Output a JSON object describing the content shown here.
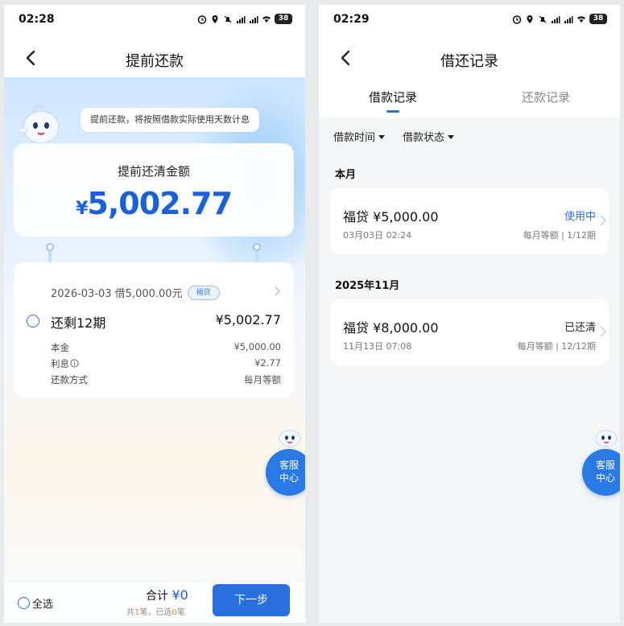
{
  "left": {
    "status_time": "02:28",
    "battery": "38",
    "title": "提前还款",
    "tip": "提前还款，将按照借款实际使用天数计息",
    "amount_label": "提前还清金额",
    "amount_currency": "¥",
    "amount_value": "5,002.77",
    "loan": {
      "header": "2026-03-03 借5,000.00元",
      "tag": "福贷",
      "periods": "还剩12期",
      "total": "¥5,002.77",
      "details": [
        {
          "label": "本金",
          "value": "¥5,000.00"
        },
        {
          "label": "利息",
          "value": "¥2.77"
        },
        {
          "label": "还款方式",
          "value": "每月等额"
        }
      ]
    },
    "service_line1": "客服",
    "service_line2": "中心",
    "select_all": "全选",
    "sum_label": "合计",
    "sum_amount": "¥0",
    "sum_sub_prefix": "共",
    "sum_sub_count": "1",
    "sum_sub_mid": "笔，已选",
    "sum_sub_selected": "0",
    "sum_sub_suffix": "笔",
    "next_button": "下一步"
  },
  "right": {
    "status_time": "02:29",
    "battery": "38",
    "title": "借还记录",
    "tabs": [
      "借款记录",
      "还款记录"
    ],
    "filters": [
      "借款时间",
      "借款状态"
    ],
    "groups": [
      {
        "title": "本月",
        "record": {
          "name": "福贷 ¥5,000.00",
          "time": "03月03日 02:24",
          "status": "使用中",
          "method": "每月等额",
          "progress": "1/12期"
        }
      },
      {
        "title": "2025年11月",
        "record": {
          "name": "福贷 ¥8,000.00",
          "time": "11月13日 07:08",
          "status": "已还清",
          "method": "每月等额",
          "progress": "12/12期"
        }
      }
    ],
    "service_line1": "客服",
    "service_line2": "中心"
  },
  "colors": {
    "accent": "#2a6ee0",
    "amount": "#1a5fe0",
    "highlight": "#f5871f"
  }
}
